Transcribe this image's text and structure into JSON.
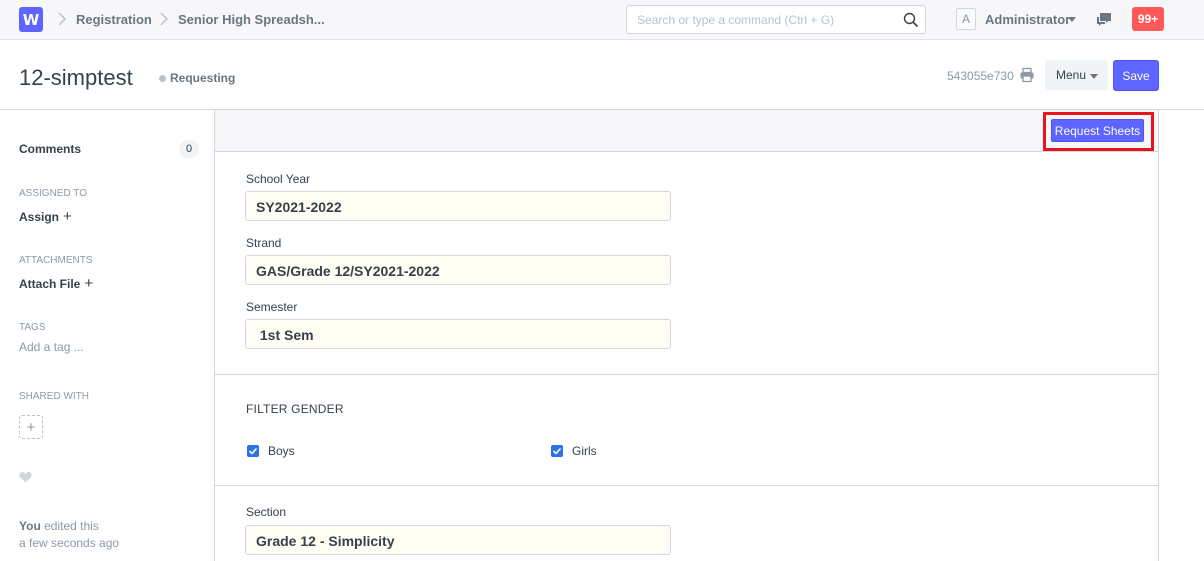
{
  "navbar": {
    "logo_letter": "W",
    "breadcrumbs": [
      "Registration",
      "Senior High Spreadsh..."
    ],
    "search_placeholder": "Search or type a command (Ctrl + G)",
    "avatar_letter": "A",
    "user_name": "Administrator",
    "notification_count": "99+"
  },
  "page_head": {
    "title": "12-simptest",
    "status": "Requesting",
    "doc_id": "543055e730",
    "menu_label": "Menu",
    "save_label": "Save"
  },
  "sidebar": {
    "comments_label": "Comments",
    "comments_count": "0",
    "assigned_to_heading": "ASSIGNED TO",
    "assign_label": "Assign",
    "attachments_heading": "ATTACHMENTS",
    "attach_label": "Attach File",
    "tags_heading": "TAGS",
    "add_tag_label": "Add a tag ...",
    "shared_with_heading": "SHARED WITH",
    "activity_user": "You",
    "activity_action": "edited this",
    "activity_time": "a few seconds ago"
  },
  "form": {
    "request_button_label": "Request Sheets",
    "fields": [
      {
        "label": "School Year",
        "value": "SY2021-2022"
      },
      {
        "label": "Strand",
        "value": "GAS/Grade 12/SY2021-2022"
      },
      {
        "label": "Semester",
        "value": " 1st Sem"
      }
    ],
    "filter_heading": "FILTER GENDER",
    "checkboxes": [
      {
        "label": "Boys",
        "checked": true
      },
      {
        "label": "Girls",
        "checked": true
      }
    ],
    "section_field": {
      "label": "Section",
      "value": "Grade 12 - Simplicity"
    }
  },
  "colors": {
    "primary": "#5e64ff",
    "highlight": "#e8131e",
    "notification": "#ff5858",
    "checkbox": "#2a73e8"
  }
}
